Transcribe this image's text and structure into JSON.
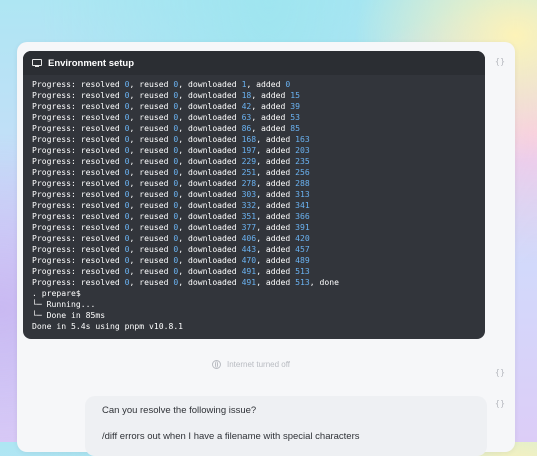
{
  "terminal": {
    "title": "Environment setup",
    "progress_prefix": "Progress: resolved ",
    "progress_lines": [
      {
        "resolved": "0",
        "reused": "0",
        "downloaded": "1",
        "added": "0"
      },
      {
        "resolved": "0",
        "reused": "0",
        "downloaded": "18",
        "added": "15"
      },
      {
        "resolved": "0",
        "reused": "0",
        "downloaded": "42",
        "added": "39"
      },
      {
        "resolved": "0",
        "reused": "0",
        "downloaded": "63",
        "added": "53"
      },
      {
        "resolved": "0",
        "reused": "0",
        "downloaded": "86",
        "added": "85"
      },
      {
        "resolved": "0",
        "reused": "0",
        "downloaded": "168",
        "added": "163"
      },
      {
        "resolved": "0",
        "reused": "0",
        "downloaded": "197",
        "added": "203"
      },
      {
        "resolved": "0",
        "reused": "0",
        "downloaded": "229",
        "added": "235"
      },
      {
        "resolved": "0",
        "reused": "0",
        "downloaded": "251",
        "added": "256"
      },
      {
        "resolved": "0",
        "reused": "0",
        "downloaded": "278",
        "added": "288"
      },
      {
        "resolved": "0",
        "reused": "0",
        "downloaded": "303",
        "added": "313"
      },
      {
        "resolved": "0",
        "reused": "0",
        "downloaded": "332",
        "added": "341"
      },
      {
        "resolved": "0",
        "reused": "0",
        "downloaded": "351",
        "added": "366"
      },
      {
        "resolved": "0",
        "reused": "0",
        "downloaded": "377",
        "added": "391"
      },
      {
        "resolved": "0",
        "reused": "0",
        "downloaded": "406",
        "added": "420"
      },
      {
        "resolved": "0",
        "reused": "0",
        "downloaded": "443",
        "added": "457"
      },
      {
        "resolved": "0",
        "reused": "0",
        "downloaded": "470",
        "added": "489"
      },
      {
        "resolved": "0",
        "reused": "0",
        "downloaded": "491",
        "added": "513"
      },
      {
        "resolved": "0",
        "reused": "0",
        "downloaded": "491",
        "added": "513",
        "suffix": ", done"
      }
    ],
    "prepare_line": ". prepare$",
    "running_line": "└─ Running...",
    "done_line": "└─ Done in 85ms",
    "final_line": "Done in 5.4s using pnpm v10.8.1"
  },
  "status": {
    "internet_label": "Internet turned off"
  },
  "message": {
    "line1": "Can you resolve the following issue?",
    "line2": "/diff errors out when I have a filename with special characters"
  },
  "icons": {
    "copy": "copy-icon",
    "globe": "globe-icon",
    "terminal": "terminal-icon"
  },
  "colors": {
    "terminal_bg": "#32353b",
    "number": "#6ab2f1",
    "accent_purple": "#c5a6f7"
  }
}
